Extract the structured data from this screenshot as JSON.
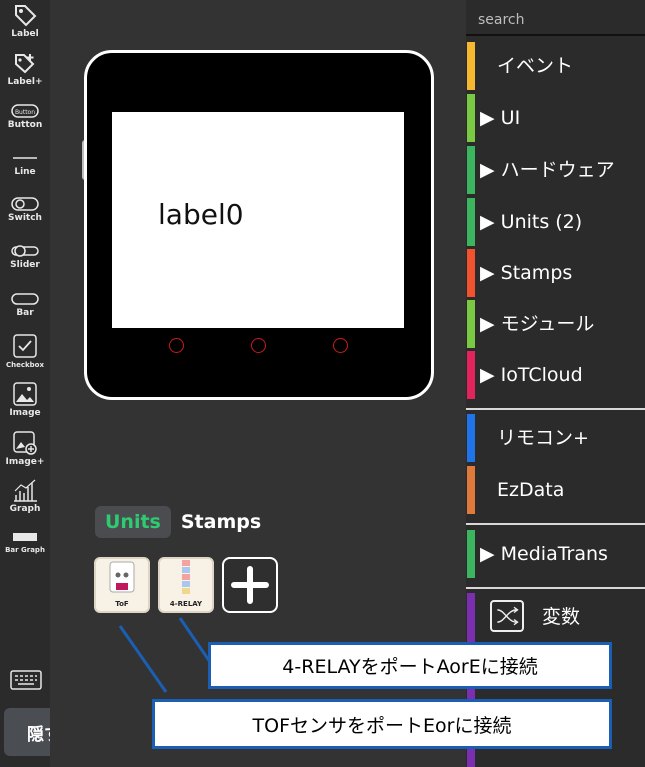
{
  "toolbar": {
    "items": [
      {
        "label": "Label",
        "icon": "tag-icon"
      },
      {
        "label": "Label+",
        "icon": "tag-plus-icon"
      },
      {
        "label": "Button",
        "icon": "button-icon",
        "inner": "Button"
      },
      {
        "label": "Line",
        "icon": "line-icon"
      },
      {
        "label": "Switch",
        "icon": "switch-icon"
      },
      {
        "label": "Slider",
        "icon": "slider-icon"
      },
      {
        "label": "Bar",
        "icon": "bar-icon"
      },
      {
        "label": "Checkbox",
        "icon": "checkbox-icon"
      },
      {
        "label": "Image",
        "icon": "image-icon"
      },
      {
        "label": "Image+",
        "icon": "image-plus-icon"
      },
      {
        "label": "Graph",
        "icon": "graph-icon"
      },
      {
        "label": "Bar Graph",
        "icon": "bar-graph-icon"
      }
    ],
    "hide_label": "隠す"
  },
  "device": {
    "label_text": "label0"
  },
  "unit_tabs": {
    "units": "Units",
    "stamps": "Stamps"
  },
  "units": [
    {
      "label": "ToF",
      "icon": "tof-sensor-icon"
    },
    {
      "label": "4-RELAY",
      "icon": "relay-icon"
    }
  ],
  "callouts": {
    "relay": "4-RELAYをポートAorEに接続",
    "tof": "TOFセンサをポートEorに接続"
  },
  "palette": {
    "search_placeholder": "search",
    "categories": [
      {
        "label": "イベント",
        "color": "#f5b82e",
        "expandable": false
      },
      {
        "label": "UI",
        "color": "#7ac943",
        "expandable": true
      },
      {
        "label": "ハードウェア",
        "color": "#3cb55f",
        "expandable": true
      },
      {
        "label": "Units (2)",
        "color": "#3cb55f",
        "expandable": true
      },
      {
        "label": "Stamps",
        "color": "#f2522e",
        "expandable": true
      },
      {
        "label": "モジュール",
        "color": "#7ac943",
        "expandable": true
      },
      {
        "label": "IoTCloud",
        "color": "#e3245c",
        "expandable": true
      },
      {
        "label": "リモコン+",
        "color": "#1e74e8",
        "expandable": false
      },
      {
        "label": "EzData",
        "color": "#e07a3a",
        "expandable": false
      },
      {
        "label": "MediaTrans",
        "color": "#3cb55f",
        "expandable": true
      },
      {
        "label": "変数",
        "color": "#7b2fb0",
        "expandable": false
      }
    ]
  }
}
